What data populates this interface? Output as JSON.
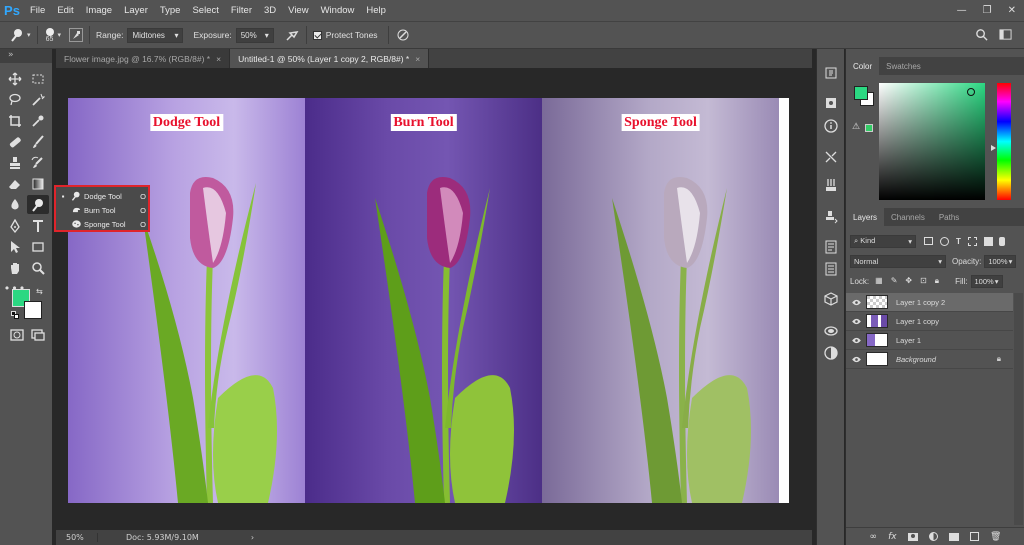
{
  "app": {
    "logo": "Ps"
  },
  "menu": [
    "File",
    "Edit",
    "Image",
    "Layer",
    "Type",
    "Select",
    "Filter",
    "3D",
    "View",
    "Window",
    "Help"
  ],
  "window_controls": {
    "minimize": "—",
    "restore": "❐",
    "close": "✕"
  },
  "options": {
    "brush_size": "65",
    "range_label": "Range:",
    "range_value": "Midtones",
    "exposure_label": "Exposure:",
    "exposure_value": "50%",
    "protect_tones_label": "Protect Tones"
  },
  "tabs": [
    {
      "label": "Flower image.jpg @ 16.7% (RGB/8#) *",
      "close": "×"
    },
    {
      "label": "Untitled-1 @ 50% (Layer 1 copy 2, RGB/8#) *",
      "close": "×"
    }
  ],
  "canvas": {
    "labels": [
      "Dodge Tool",
      "Burn Tool",
      "Sponge Tool"
    ]
  },
  "flyout": {
    "items": [
      {
        "label": "Dodge Tool",
        "key": "O",
        "bullet": "▪"
      },
      {
        "label": "Burn Tool",
        "key": "O",
        "bullet": ""
      },
      {
        "label": "Sponge Tool",
        "key": "O",
        "bullet": ""
      }
    ]
  },
  "status": {
    "zoom": "50%",
    "doc": "Doc: 5.93M/9.10M",
    "arrow": "›"
  },
  "color_panel": {
    "tabs": [
      "Color",
      "Swatches"
    ],
    "foreground": "#2bd882",
    "background": "#ffffff"
  },
  "layers_panel": {
    "tabs": [
      "Layers",
      "Channels",
      "Paths"
    ],
    "filter_kind": "Kind",
    "blend_mode": "Normal",
    "opacity_label": "Opacity:",
    "opacity_value": "100%",
    "lock_label": "Lock:",
    "fill_label": "Fill:",
    "fill_value": "100%",
    "layers": [
      {
        "name": "Layer 1 copy 2",
        "selected": true
      },
      {
        "name": "Layer 1 copy",
        "selected": false
      },
      {
        "name": "Layer 1",
        "selected": false
      },
      {
        "name": "Background",
        "selected": false
      }
    ],
    "fx_label": "fx"
  },
  "colors": {
    "accent": "#31a8ff",
    "highlight_red": "#e0242b",
    "label_red": "#e8112d"
  }
}
